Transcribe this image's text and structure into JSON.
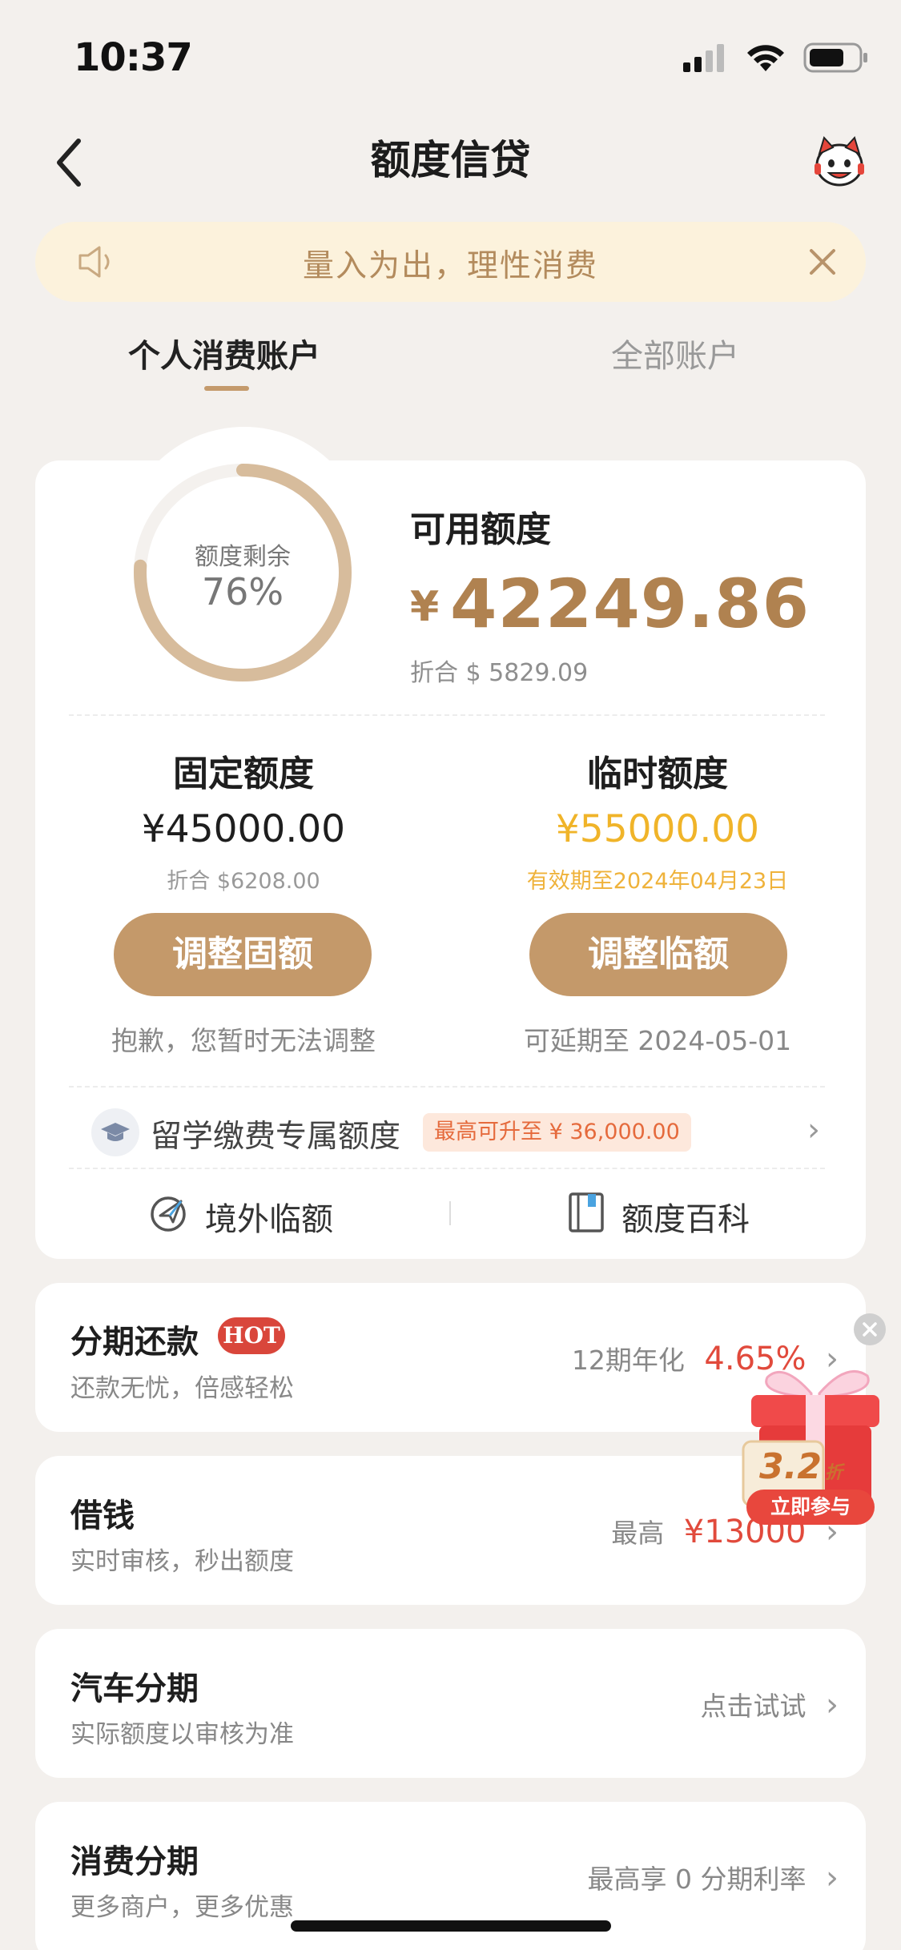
{
  "status": {
    "time": "10:37"
  },
  "nav": {
    "title": "额度信贷"
  },
  "notice": {
    "text": "量入为出，理性消费"
  },
  "tabs": [
    {
      "label": "个人消费账户"
    },
    {
      "label": "全部账户"
    }
  ],
  "quota": {
    "ring_label": "额度剩余",
    "ring_percent": "76%",
    "ring_fraction": 0.76,
    "available_label": "可用额度",
    "available_currency": "¥",
    "available_amount": "42249.86",
    "available_converted": "折合 $ 5829.09"
  },
  "fixed": {
    "title": "固定额度",
    "amount": "¥45000.00",
    "converted": "折合 $6208.00",
    "button": "调整固额",
    "note": "抱歉，您暂时无法调整"
  },
  "temporary": {
    "title": "临时额度",
    "amount": "¥55000.00",
    "validity": "有效期至2024年04月23日",
    "button": "调整临额",
    "note": "可延期至 2024-05-01"
  },
  "study": {
    "label": "留学缴费专属额度",
    "tag": "最高可升至 ¥ 36,000.00"
  },
  "links": {
    "overseas": "境外临额",
    "wiki": "额度百科"
  },
  "services": [
    {
      "title": "分期还款",
      "badge": "HOT",
      "subtitle": "还款无忧，倍感轻松",
      "right_prefix": "12期年化",
      "right_value": "4.65%"
    },
    {
      "title": "借钱",
      "subtitle": "实时审核，秒出额度",
      "right_prefix": "最高",
      "right_value": "¥13000"
    },
    {
      "title": "汽车分期",
      "subtitle": "实际额度以审核为准",
      "right_prefix": "点击试试"
    },
    {
      "title": "消费分期",
      "subtitle": "更多商户，更多优惠",
      "right_prefix": "最高享 0 分期利率"
    }
  ],
  "promo": {
    "discount": "3.2",
    "discount_unit": "折",
    "cta": "立即参与"
  },
  "colors": {
    "accent": "#c4996a",
    "gold_text": "#b08250",
    "temp_amount": "#f0b429",
    "red": "#e14a3c"
  }
}
